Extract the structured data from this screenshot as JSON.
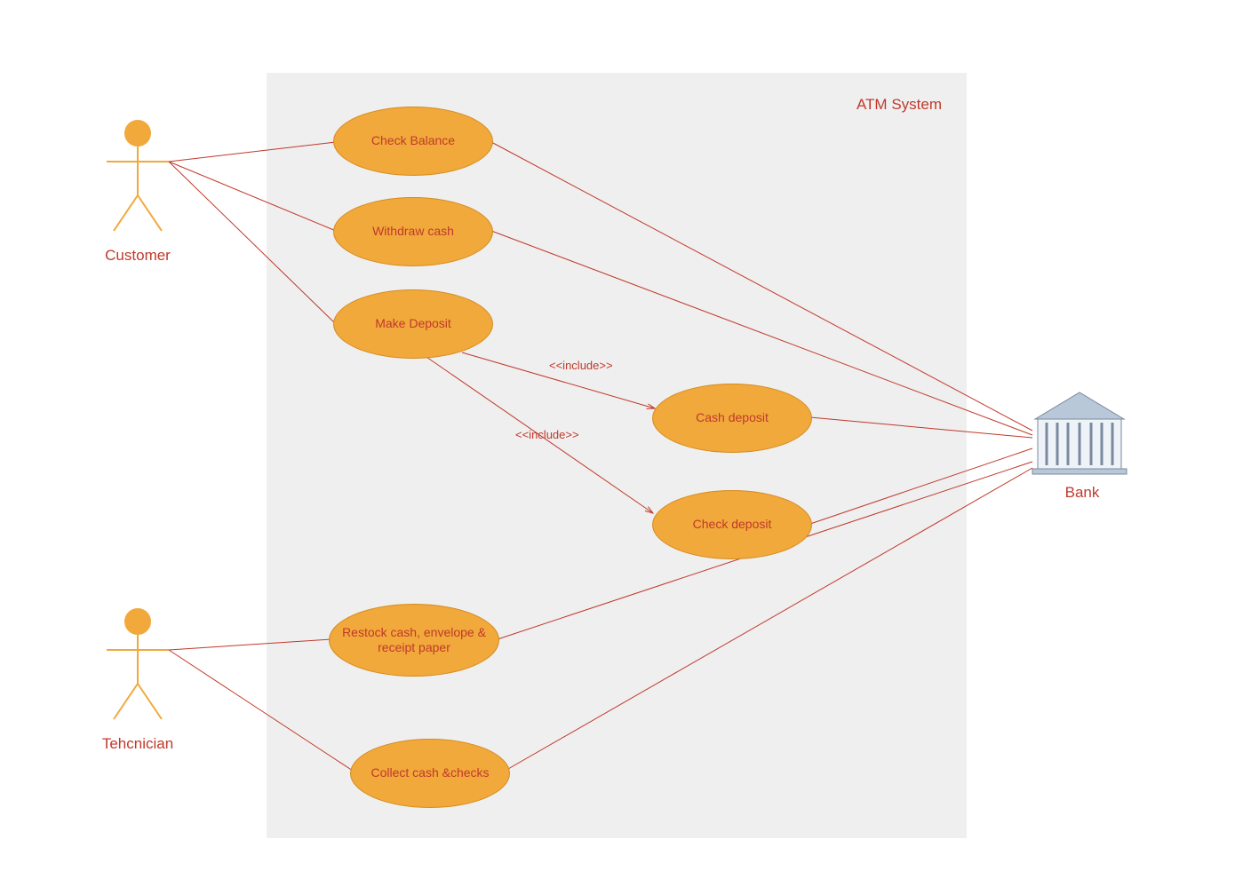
{
  "system": {
    "title": "ATM System"
  },
  "actors": {
    "customer": "Customer",
    "technician": "Tehcnician",
    "bank": "Bank"
  },
  "usecases": {
    "check_balance": "Check Balance",
    "withdraw_cash": "Withdraw cash",
    "make_deposit": "Make Deposit",
    "cash_deposit": "Cash deposit",
    "check_deposit": "Check deposit",
    "restock": "Restock cash, envelope & receipt paper",
    "collect": "Collect cash &checks"
  },
  "relations": {
    "include1": "<<include>>",
    "include2": "<<include>>"
  }
}
